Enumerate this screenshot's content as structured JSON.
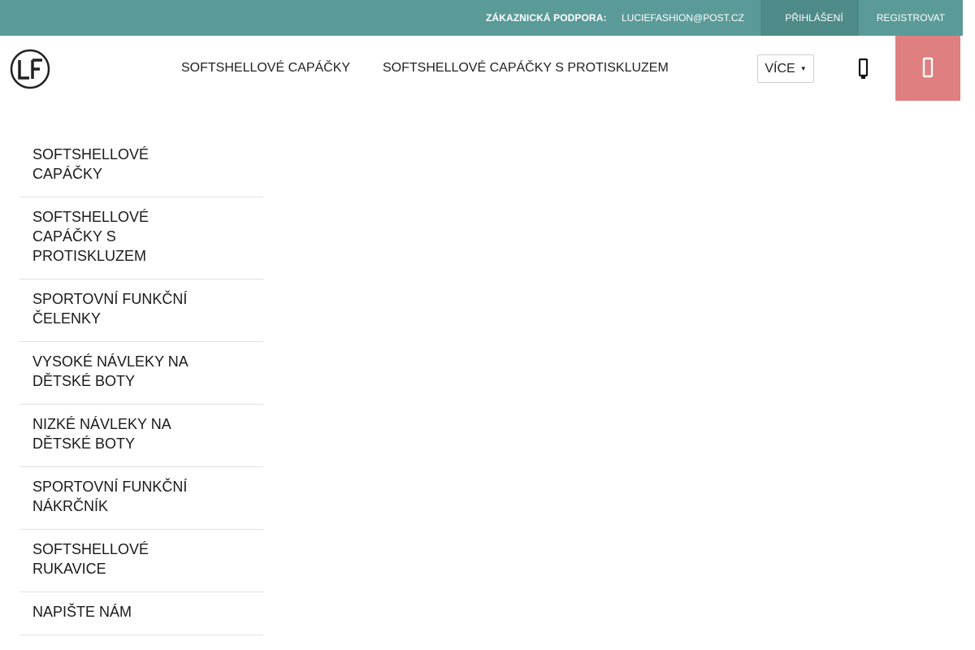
{
  "topbar": {
    "support_label": "ZÁKAZNICKÁ PODPORA:",
    "support_email": "LUCIEFASHION@POST.CZ",
    "login_label": "PŘIHLÁŠENÍ",
    "register_label": "REGISTROVAT",
    "background_color": "#5a9b99"
  },
  "header": {
    "logo_text": "LF",
    "nav": [
      {
        "label": "SOFTSHELLOVÉ CAPÁČKY"
      },
      {
        "label": "SOFTSHELLOVÉ CAPÁČKY S PROTISKLUZEM"
      }
    ],
    "more_label": "VÍCE",
    "search_icon": "search-icon",
    "cart_icon": "cart-icon",
    "cart_color": "#df7f7f"
  },
  "sidebar": {
    "items": [
      {
        "label": "SOFTSHELLOVÉ CAPÁČKY"
      },
      {
        "label": "SOFTSHELLOVÉ CAPÁČKY S PROTISKLUZEM"
      },
      {
        "label": "SPORTOVNÍ FUNKČNÍ ČELENKY"
      },
      {
        "label": "VYSOKÉ NÁVLEKY NA DĚTSKÉ BOTY"
      },
      {
        "label": "NIZKÉ NÁVLEKY NA DĚTSKÉ BOTY"
      },
      {
        "label": "SPORTOVNÍ FUNKČNÍ NÁKRČNÍK"
      },
      {
        "label": "SOFTSHELLOVÉ RUKAVICE"
      },
      {
        "label": "NAPIŠTE NÁM"
      }
    ]
  }
}
